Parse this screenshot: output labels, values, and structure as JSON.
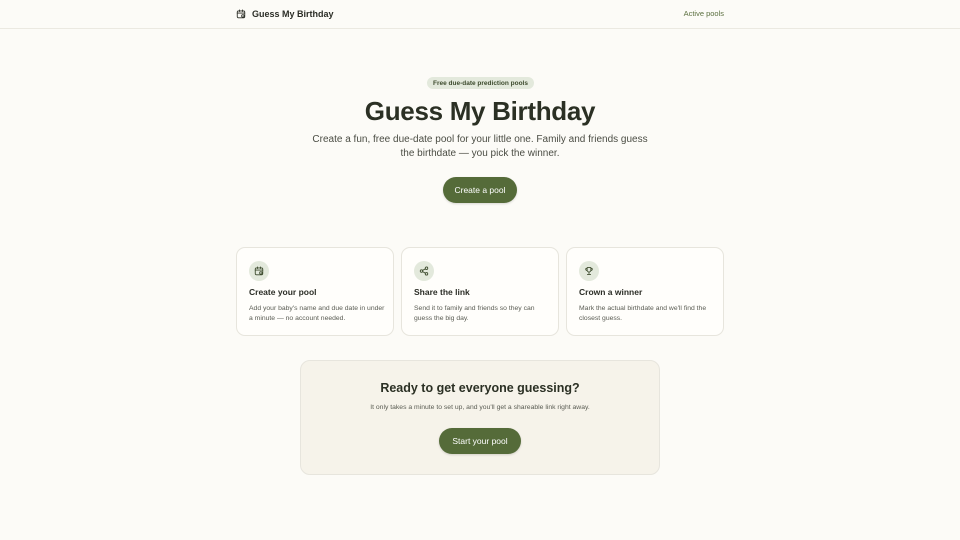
{
  "header": {
    "brand_icon": "calendar-icon",
    "brand_label": "Guess My Birthday",
    "nav_active_pools": "Active pools"
  },
  "hero": {
    "badge": "Free due-date prediction pools",
    "title": "Guess My Birthday",
    "subtitle": "Create a fun, free due-date pool for your little one. Family and friends guess the birthdate — you pick the winner.",
    "cta_label": "Create a pool"
  },
  "features": [
    {
      "icon": "calendar-icon",
      "title": "Create your pool",
      "description": "Add your baby's name and due date in under a minute — no account needed."
    },
    {
      "icon": "share-icon",
      "title": "Share the link",
      "description": "Send it to family and friends so they can guess the big day."
    },
    {
      "icon": "trophy-icon",
      "title": "Crown a winner",
      "description": "Mark the actual birthdate and we'll find the closest guess."
    }
  ],
  "cta": {
    "title": "Ready to get everyone guessing?",
    "subtitle": "It only takes a minute to set up, and you'll get a shareable link right away.",
    "button_label": "Start your pool"
  },
  "colors": {
    "accent": "#556b39",
    "background": "#fcfbf7",
    "badge_bg": "#e3e9dc"
  }
}
